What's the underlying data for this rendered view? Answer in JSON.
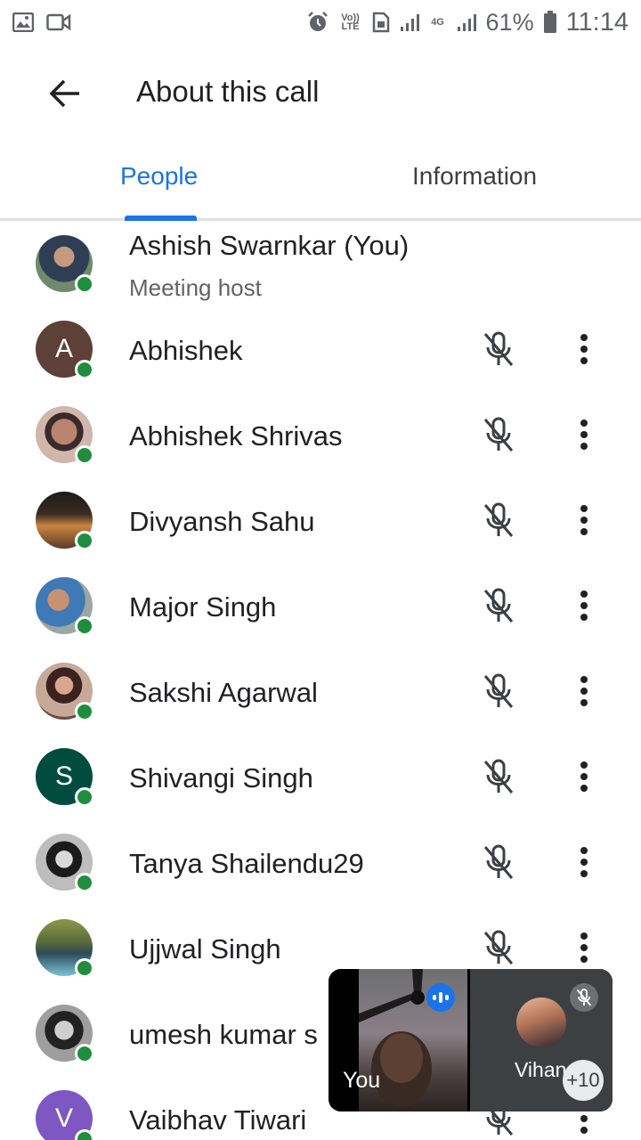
{
  "status_bar": {
    "left_icons": [
      "gallery-icon",
      "video-camera-icon"
    ],
    "volte_label": "Vo)) LTE",
    "network_label": "4G",
    "battery": "61%",
    "time": "11:14"
  },
  "header": {
    "title": "About this call",
    "back_icon": "arrow-back-icon"
  },
  "tabs": [
    {
      "label": "People",
      "active": true
    },
    {
      "label": "Information",
      "active": false
    }
  ],
  "colors": {
    "accent": "#1a73e8",
    "online": "#1e8e3e"
  },
  "participants": [
    {
      "name": "Ashish Swarnkar (You)",
      "role": "Meeting host",
      "avatar": "photo",
      "avatar_color": "#7a8b6f"
    },
    {
      "name": "Abhishek",
      "avatar": "letter",
      "initial": "A",
      "avatar_color": "#5d4037"
    },
    {
      "name": "Abhishek Shrivas",
      "avatar": "photo",
      "avatar_color": "#8d5a4a"
    },
    {
      "name": "Divyansh Sahu",
      "avatar": "photo",
      "avatar_color": "#8b6a4a"
    },
    {
      "name": "Major Singh",
      "avatar": "photo",
      "avatar_color": "#4e6f8e"
    },
    {
      "name": "Sakshi Agarwal",
      "avatar": "photo",
      "avatar_color": "#a77d6c"
    },
    {
      "name": "Shivangi Singh",
      "avatar": "letter",
      "initial": "S",
      "avatar_color": "#004d40"
    },
    {
      "name": "Tanya Shailendu29",
      "avatar": "photo",
      "avatar_color": "#9e9e9e"
    },
    {
      "name": "Ujjwal Singh",
      "avatar": "photo",
      "avatar_color": "#6f8d5a"
    },
    {
      "name": "umesh kumar s",
      "avatar": "photo",
      "avatar_color": "#6b6b6b"
    },
    {
      "name": "Vaibhav Tiwari",
      "avatar": "letter",
      "initial": "V",
      "avatar_color": "#7e57c2"
    }
  ],
  "pip": {
    "self_label": "You",
    "other_name": "Vihan",
    "more_count": "+10"
  }
}
